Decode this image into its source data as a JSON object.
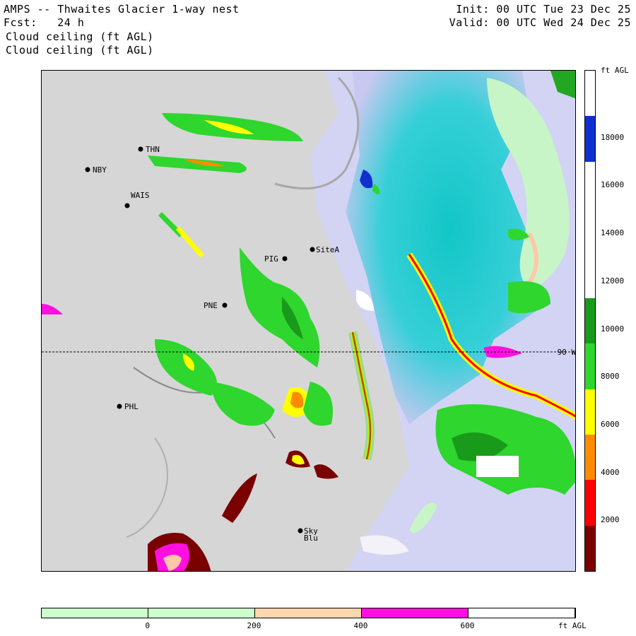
{
  "header": {
    "title": "AMPS -- Thwaites Glacier 1-way nest",
    "fcst": "Fcst:   24 h",
    "field1": "Cloud ceiling (ft AGL)",
    "field2": "Cloud ceiling (ft AGL)",
    "init": "Init: 00 UTC Tue 23 Dec 25",
    "valid": "Valid: 00 UTC Wed 24 Dec 25"
  },
  "map": {
    "parallel_label": "90 W",
    "stations": [
      "THN",
      "NBY",
      "WAIS",
      "SiteA",
      "PIG",
      "PNE",
      "PHL",
      "Sky",
      "Blu"
    ]
  },
  "colorbar_right": {
    "unit": "ft AGL",
    "ticks": [
      "18000",
      "16000",
      "14000",
      "12000",
      "10000",
      "8000",
      "6000",
      "4000",
      "2000"
    ],
    "colors": [
      "#ffffff",
      "#1030d0",
      "#ffffff",
      "#ffffff",
      "#ffffff",
      "#1a9a1a",
      "#2ed62e",
      "#ffff00",
      "#ff8c00",
      "#ff0000",
      "#7a0000"
    ]
  },
  "colorbar_bottom": {
    "unit": "ft AGL",
    "ticks": [
      "0",
      "200",
      "400",
      "600"
    ],
    "colors": [
      "#ccffcc",
      "#ccffcc",
      "#ffd6b0",
      "#ff10e0",
      "#ffffff"
    ]
  }
}
